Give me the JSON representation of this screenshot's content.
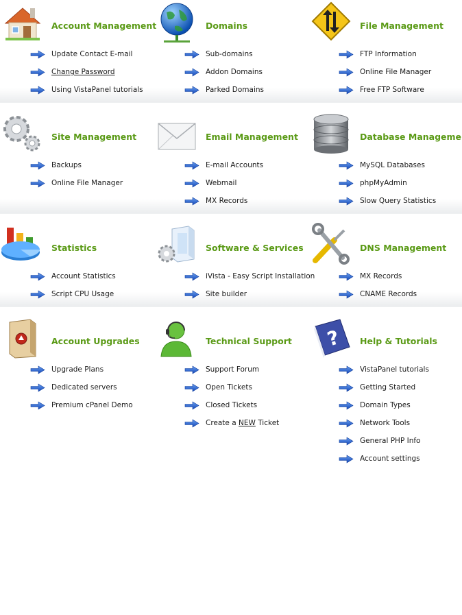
{
  "colors": {
    "title": "#5a9a16",
    "text": "#1a1a1a",
    "arrow": "#1f5fd0"
  },
  "sections": [
    {
      "title": "Account Management",
      "icon": "house-icon",
      "items": [
        "Update Contact E-mail",
        "Change Password",
        "Using VistaPanel tutorials"
      ]
    },
    {
      "title": "Domains",
      "icon": "globe-icon",
      "items": [
        "Sub-domains",
        "Addon Domains",
        "Parked Domains"
      ]
    },
    {
      "title": "File Management",
      "icon": "transfer-sign-icon",
      "items": [
        "FTP Information",
        "Online File Manager",
        "Free FTP Software"
      ]
    },
    {
      "title": "Site Management",
      "icon": "gears-icon",
      "items": [
        "Backups",
        "Online File Manager"
      ]
    },
    {
      "title": "Email Management",
      "icon": "envelope-icon",
      "items": [
        "E-mail Accounts",
        "Webmail",
        "MX Records"
      ]
    },
    {
      "title": "Database Management",
      "icon": "database-icon",
      "items": [
        "MySQL Databases",
        "phpMyAdmin",
        "Slow Query Statistics"
      ]
    },
    {
      "title": "Statistics",
      "icon": "statistics-chart-icon",
      "items": [
        "Account Statistics",
        "Script CPU Usage"
      ]
    },
    {
      "title": "Software & Services",
      "icon": "software-box-icon",
      "items": [
        "iVista - Easy Script Installation",
        "Site builder"
      ]
    },
    {
      "title": "DNS Management",
      "icon": "tools-icon",
      "items": [
        "MX Records",
        "CNAME Records"
      ]
    },
    {
      "title": "Account Upgrades",
      "icon": "upgrade-server-icon",
      "items": [
        "Upgrade Plans",
        "Dedicated servers",
        "Premium cPanel Demo"
      ]
    },
    {
      "title": "Technical Support",
      "icon": "support-agent-icon",
      "items": [
        "Support Forum",
        "Open Tickets",
        "Closed Tickets"
      ],
      "new_ticket": {
        "before": "Create a ",
        "emph": "NEW",
        "after": " Ticket"
      }
    },
    {
      "title": "Help & Tutorials",
      "icon": "help-book-icon",
      "items": [
        "VistaPanel tutorials",
        "Getting Started",
        "Domain Types",
        "Network Tools",
        "General PHP Info",
        "Account settings"
      ]
    }
  ]
}
